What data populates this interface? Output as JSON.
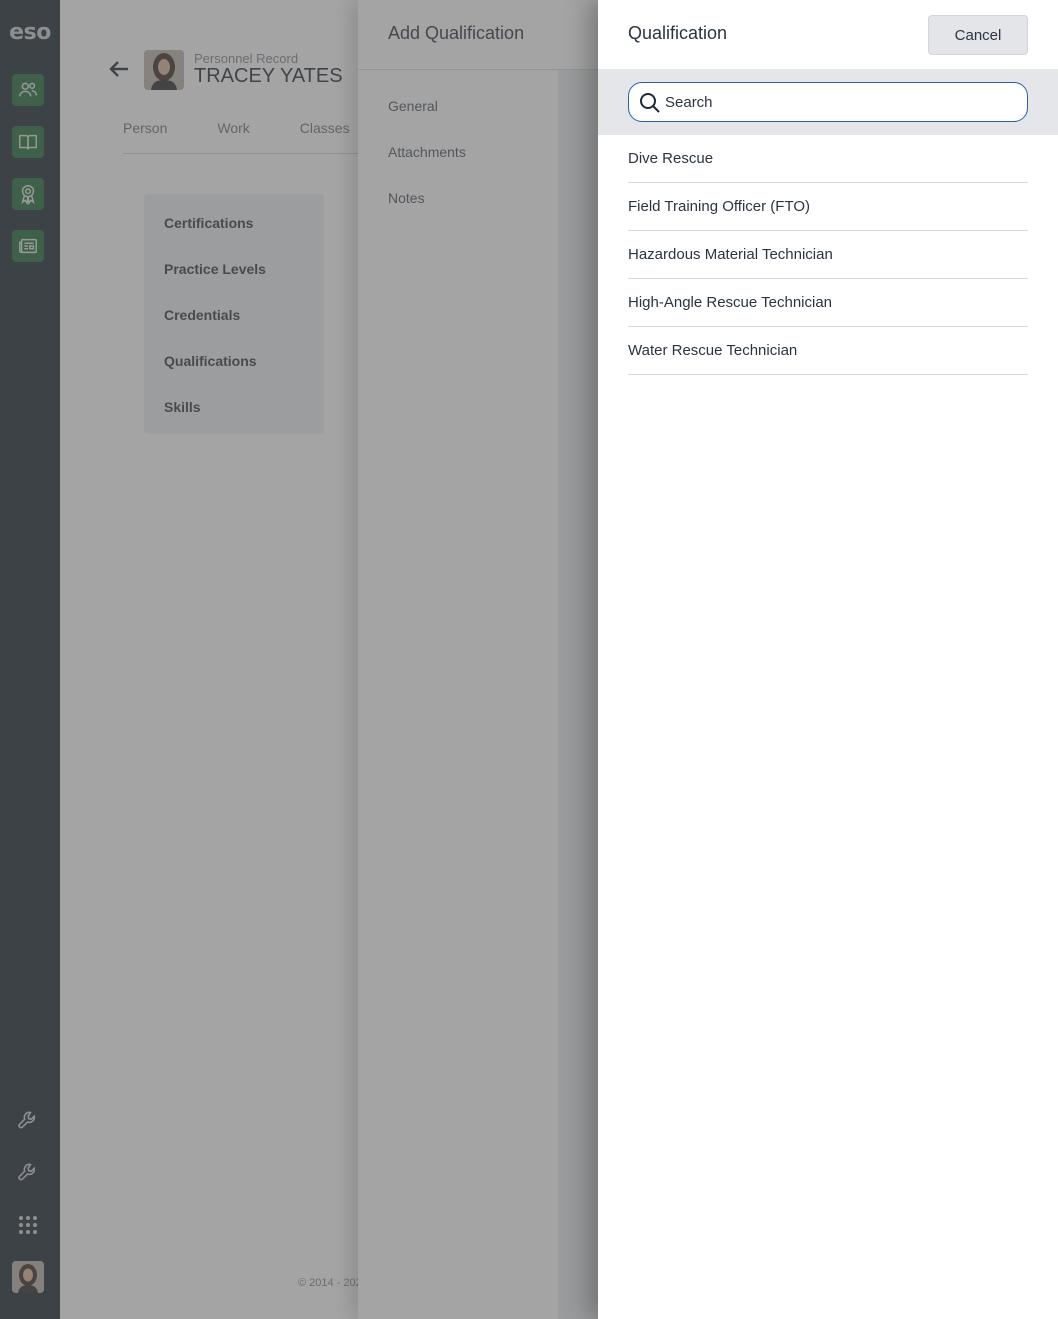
{
  "rail": {
    "logo": "eso",
    "nav_icons": [
      "people-icon",
      "book-icon",
      "award-icon",
      "newspaper-icon"
    ],
    "tool_icons": [
      "wrench-icon",
      "wrench-icon",
      "apps-grid-icon"
    ],
    "accent": "#1f6a36"
  },
  "page": {
    "record_label": "Personnel Record",
    "person_name": "TRACEY YATES",
    "tabs": [
      "Person",
      "Work",
      "Classes"
    ],
    "subnav": [
      "Certifications",
      "Practice Levels",
      "Credentials",
      "Qualifications",
      "Skills"
    ],
    "copyright": "© 2014 - 202"
  },
  "add_panel": {
    "title": "Add Qualification",
    "nav": [
      "General",
      "Attachments",
      "Notes"
    ]
  },
  "picker": {
    "title": "Qualification",
    "cancel_label": "Cancel",
    "search_placeholder": "Search",
    "items": [
      "Dive Rescue",
      "Field Training Officer (FTO)",
      "Hazardous Material Technician",
      "High-Angle Rescue Technician",
      "Water Rescue Technician"
    ]
  }
}
